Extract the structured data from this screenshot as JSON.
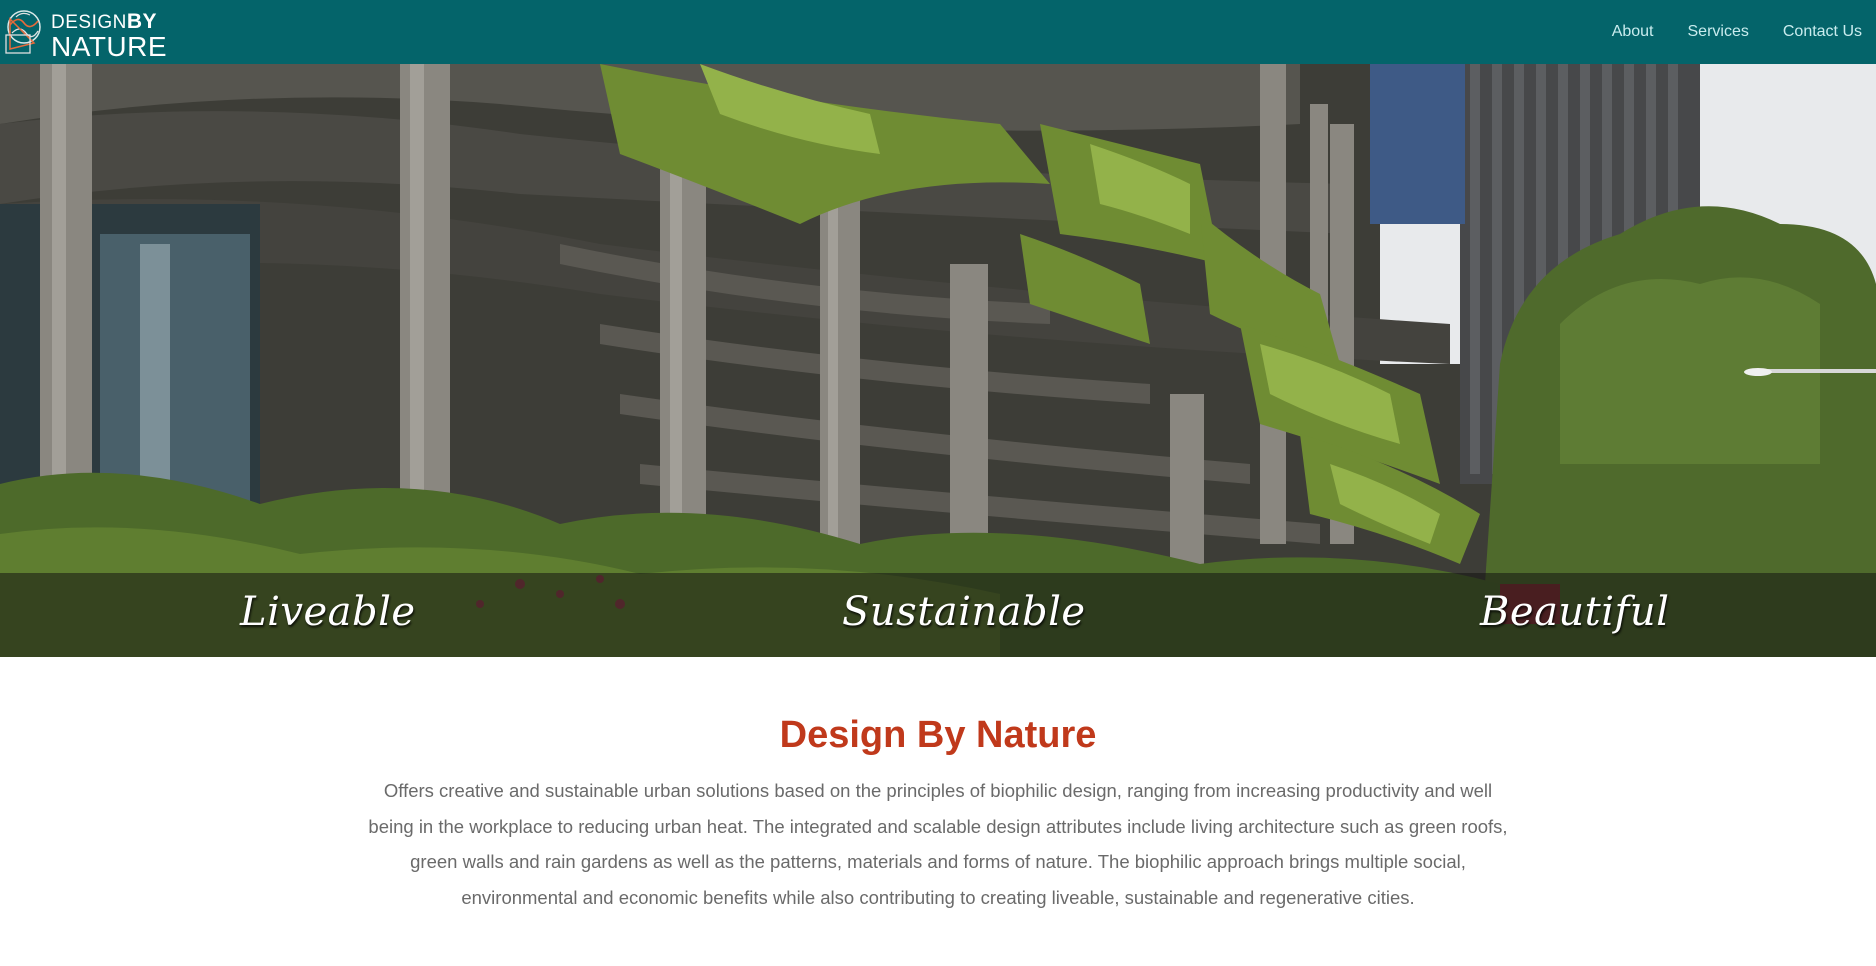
{
  "header": {
    "logo_line1": "DESIGN",
    "logo_by": "BY",
    "logo_line2": "NATURE",
    "background_color": "#04646a",
    "nav": [
      {
        "label": "About"
      },
      {
        "label": "Services"
      },
      {
        "label": "Contact Us"
      }
    ]
  },
  "hero": {
    "words": [
      "Liveable",
      "Sustainable",
      "Beautiful"
    ]
  },
  "intro": {
    "title": "Design By Nature",
    "title_color": "#c0391b",
    "body": "Offers creative and sustainable urban solutions based on the principles of biophilic design, ranging from increasing productivity and well being in the workplace to reducing urban heat. The integrated and scalable design attributes include living architecture such as green roofs, green walls and rain gardens as well as the patterns, materials and forms of nature. The biophilic approach brings multiple social, environmental and economic benefits while also contributing to creating liveable, sustainable and regenerative cities."
  }
}
